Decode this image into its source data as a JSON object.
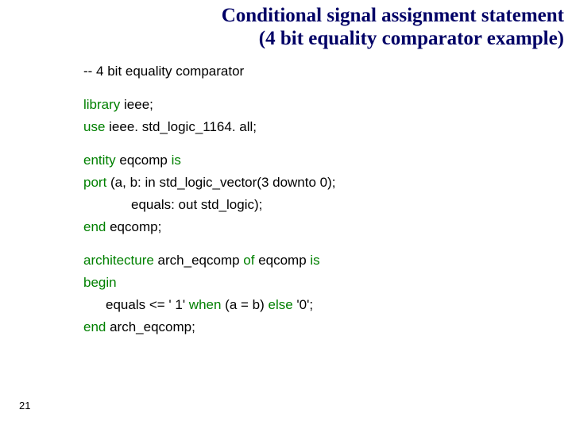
{
  "title_line1": "Conditional signal assignment statement",
  "title_line2": "(4 bit equality comparator example)",
  "code": {
    "l1_comment": "-- 4 bit equality comparator",
    "l2_kw": "library",
    "l2_rest": " ieee;",
    "l3_kw": "use",
    "l3_rest": " ieee. std_logic_1164. all;",
    "l4_kw1": "entity",
    "l4_mid": " eqcomp ",
    "l4_kw2": "is",
    "l5_kw": "port",
    "l5_rest": " (a, b: in std_logic_vector(3 downto 0);",
    "l6_rest": "equals: out std_logic);",
    "l7_kw": "end",
    "l7_rest": " eqcomp;",
    "l8_kw1": "architecture",
    "l8_mid": " arch_eqcomp ",
    "l8_kw2": "of",
    "l8_mid2": " eqcomp ",
    "l8_kw3": "is",
    "l9_kw": "begin",
    "l10_a": "equals <= ' 1' ",
    "l10_kw1": "when",
    "l10_b": " (a = b) ",
    "l10_kw2": "else",
    "l10_c": " '0';",
    "l11_kw": "end",
    "l11_rest": " arch_eqcomp;"
  },
  "page_number": "21"
}
